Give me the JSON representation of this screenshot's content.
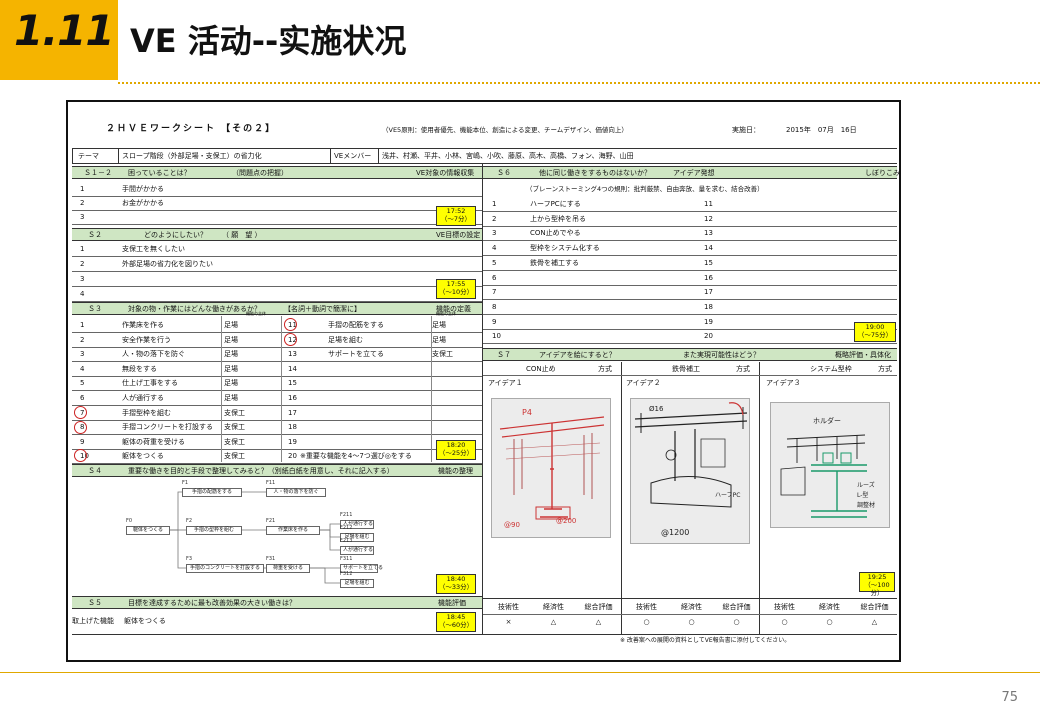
{
  "slide": {
    "number": "1.11",
    "title": "VE 活动--实施状况",
    "page_number": "75"
  },
  "sheet": {
    "title": "２ＨＶＥワークシート 【その２】",
    "principles": "（VE5原則：使用者優先、機能本位、創造による変更、チームデザイン、価値向上）",
    "date_label": "実施日：",
    "date_value": "2015年　07月　16日",
    "theme_label": "テーマ",
    "theme_value": "スロープ階段（外部足場・支保工）の省力化",
    "members_label": "VEメンバー",
    "members_value": "浅井、村瀬、平井、小林、宮嶋、小吹、藤原、高木、高橋、フォン、海野、山田",
    "s12": {
      "no": "Ｓ１－２",
      "question": "困っていることは？",
      "sub": "（問題点の把握）",
      "right": "VE対象の情報収集",
      "items": [
        "手間がかかる",
        "お金がかかる"
      ],
      "nums": [
        "1",
        "2",
        "3"
      ],
      "time": "17:52\n（〜7分）"
    },
    "s2": {
      "no": "Ｓ２",
      "question": "どのようにしたい？",
      "sub": "（ 願　望 ）",
      "right": "VE目標の設定",
      "items": [
        "支保工を無くしたい",
        "外部足場の省力化を図りたい"
      ],
      "nums": [
        "1",
        "2",
        "3",
        "4"
      ],
      "time": "17:55\n（〜10分）"
    },
    "s3": {
      "no": "Ｓ３",
      "question": "対象の物・作業にはどんな働きがあるか？",
      "sub": "【名詞＋動詞で簡潔に】",
      "right": "機能の定義",
      "small_a": "機能の主体",
      "small_b": "機能の主体",
      "left_nums": [
        "1",
        "2",
        "3",
        "4",
        "5",
        "6",
        "7",
        "8",
        "9",
        "10"
      ],
      "left_items": [
        "作業床を作る",
        "安全作業を行う",
        "人・物の落下を防ぐ",
        "無段をする",
        "仕上げ工事をする",
        "人が通行する",
        "手摺型枠を組む",
        "手摺コンクリートを打設する",
        "躯体の荷重を受ける",
        "躯体をつくる"
      ],
      "left_owner": [
        "足場",
        "足場",
        "足場",
        "足場",
        "足場",
        "足場",
        "支保工",
        "支保工",
        "支保工",
        "支保工"
      ],
      "right_nums": [
        "11",
        "12",
        "13",
        "14",
        "15",
        "16",
        "17",
        "18",
        "19",
        "20"
      ],
      "right_items": [
        "手摺の配筋をする",
        "足場を組む",
        "サポートを立てる",
        "",
        "",
        "",
        "",
        "",
        "",
        "※重要な機能を4〜7つ選び◎をする"
      ],
      "right_owner": [
        "足場",
        "足場",
        "支保工"
      ],
      "time": "18:20\n（〜25分）"
    },
    "s4": {
      "no": "Ｓ４",
      "question": "重要な働きを目的と手段で整理してみると？（別紙白紙を用意し、それに記入する）",
      "right": "機能の整理",
      "nodes": [
        {
          "tag": "F1",
          "label": "手摺の配筋をする"
        },
        {
          "tag": "F11",
          "label": "人・物の落下を防ぐ"
        },
        {
          "tag": "F0",
          "label": "躯体をつくる"
        },
        {
          "tag": "F2",
          "label": "手摺の型枠を組む"
        },
        {
          "tag": "F21",
          "label": "作業床を作る"
        },
        {
          "tag": "F211",
          "label": "人が通行する"
        },
        {
          "tag": "F212",
          "label": "足場を組む"
        },
        {
          "tag": "F213",
          "label": "人が通行する"
        },
        {
          "tag": "F3",
          "label": "手摺のコンクリートを打設する"
        },
        {
          "tag": "F31",
          "label": "荷重を受ける"
        },
        {
          "tag": "F311",
          "label": "サポートを立てる"
        },
        {
          "tag": "F312",
          "label": "足場を組む"
        }
      ],
      "time": "18:40\n（〜33分）"
    },
    "s5": {
      "no": "Ｓ５",
      "question": "目標を達成するために最も改善効果の大きい働きは？",
      "right": "機能評価",
      "label": "取上げた機能",
      "value": "躯体をつくる",
      "time": "18:45\n（〜60分）"
    },
    "s6": {
      "no": "Ｓ６",
      "question": "他に同じ働きをするものはないか？",
      "sub": "アイデア発想",
      "right": "しぼりこみ",
      "rule": "（ブレーンストーミング4つの規則：批判厳禁、自由奔放、量を求む、結合改善）",
      "nums_left": [
        "1",
        "2",
        "3",
        "4",
        "5",
        "6",
        "7",
        "8",
        "9",
        "10"
      ],
      "items_left": [
        "ハーフPCにする",
        "上から型枠を吊る",
        "CON止めでやる",
        "型枠をシステム化する",
        "鉄骨を補工する",
        "",
        "",
        "",
        "",
        ""
      ],
      "nums_right": [
        "11",
        "12",
        "13",
        "14",
        "15",
        "16",
        "17",
        "18",
        "19",
        "20"
      ],
      "time": "19:00\n（〜75分）"
    },
    "s7": {
      "no": "Ｓ７",
      "question": "アイデアを絵にすると？",
      "sub": "また実現可能性はどう？",
      "right": "概略評価・具体化",
      "methods": [
        "CON止め",
        "鉄骨補工",
        "システム型枠"
      ],
      "method_label": "方式",
      "ideas": [
        "アイデア１",
        "アイデア２",
        "アイデア３"
      ],
      "eval_headers": [
        "技術性",
        "経済性",
        "総合評価"
      ],
      "evals": [
        [
          "×",
          "△",
          "△"
        ],
        [
          "○",
          "○",
          "○"
        ],
        [
          "○",
          "○",
          "△"
        ]
      ],
      "time": "19:25\n（〜100分）",
      "note": "※ 改善案への展開の資料としてVE報告書に添付してください。",
      "sketch_labels": [
        "P4",
        "@90",
        "Ø16",
        "@200",
        "100",
        "@1200",
        "1700",
        "ハーフPC",
        "ホルダー",
        "ルーズ",
        "L-型",
        "調整材"
      ]
    }
  }
}
